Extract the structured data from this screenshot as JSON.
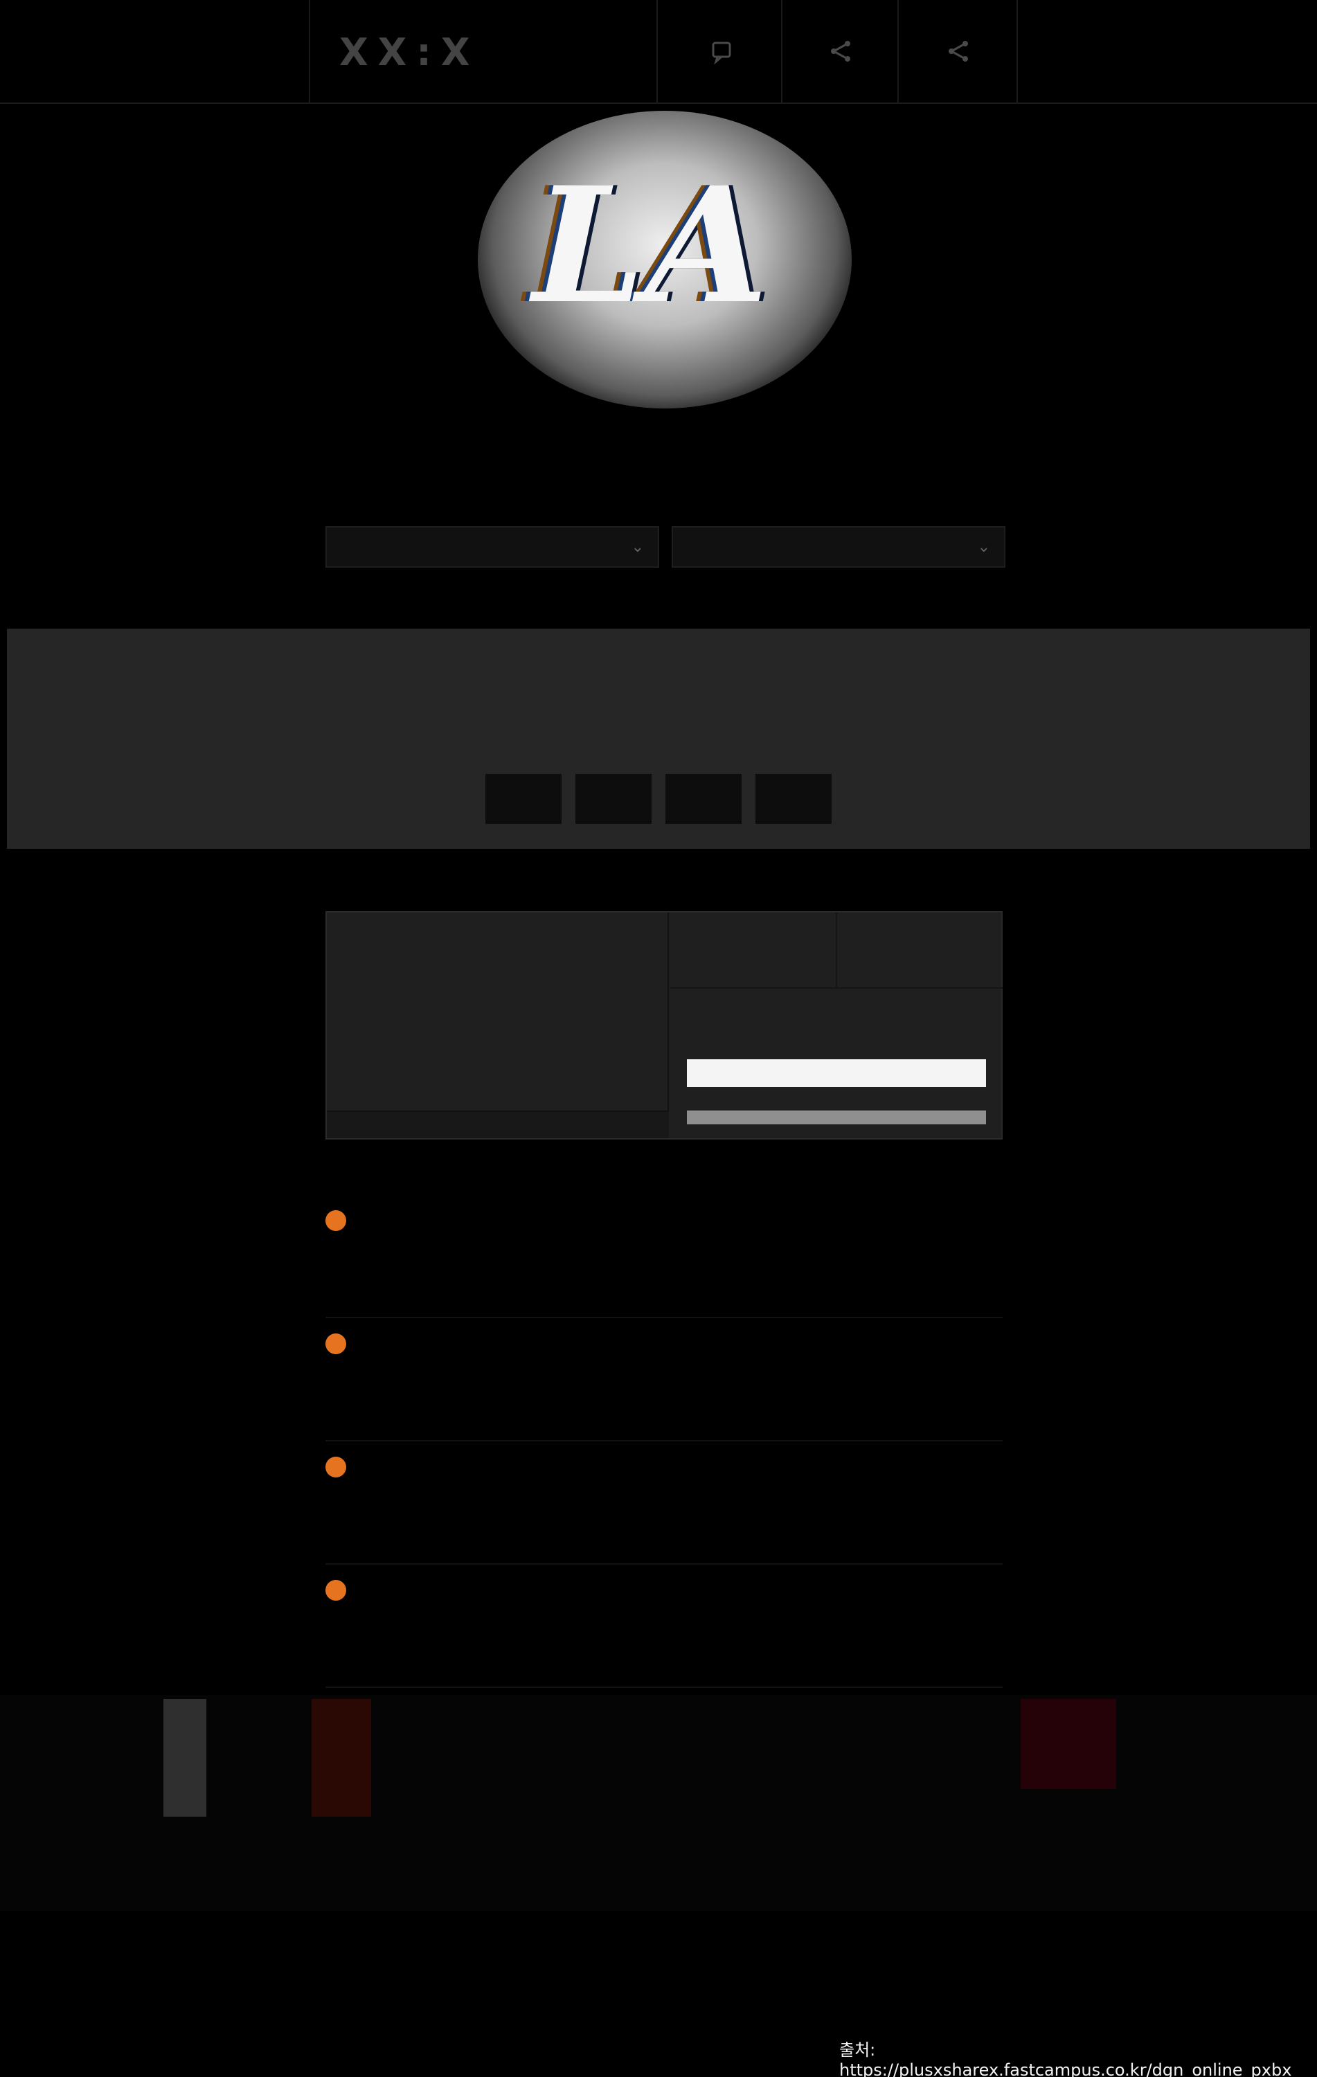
{
  "header": {
    "logo": "XX:X",
    "logo_sub": "",
    "icons": [
      "chat-icon",
      "share-icon",
      "share-alt-icon"
    ]
  },
  "hero": {
    "image_glyph": "LA",
    "title": "",
    "subtitle": "",
    "tags": [
      "",
      "",
      "",
      "",
      ""
    ]
  },
  "selects": [
    {
      "value": ""
    },
    {
      "value": ""
    }
  ],
  "notice": {
    "brand": "",
    "text_before": "",
    "highlight": "",
    "text_after": "",
    "buttons": [
      "",
      "",
      "",
      ""
    ]
  },
  "course_card": {
    "title": "",
    "note_line1": "",
    "note_line2": "",
    "footer_text": "",
    "options": [
      {
        "top": "",
        "label": ""
      },
      {
        "top": "",
        "label": ""
      }
    ],
    "price": "",
    "buy_label": ""
  },
  "info_rows": [
    {
      "label": "",
      "line1": "",
      "line2": "",
      "desc1": "",
      "desc2": ""
    },
    {
      "label": "",
      "line1": "",
      "line2": "",
      "desc1": "",
      "desc2": ""
    },
    {
      "label": "",
      "line1": "",
      "line2": "",
      "desc1": "",
      "desc2": ""
    },
    {
      "label": "",
      "line1": "",
      "line2": "",
      "desc1": "",
      "desc2": ""
    }
  ],
  "instructor": {
    "brand": "",
    "subtitle": "",
    "title": "",
    "desc_line1": "",
    "desc_line2": ""
  },
  "bottom": {
    "heading": "",
    "line1": "",
    "line2": ""
  },
  "source": "출처: https://plusxsharex.fastcampus.co.kr/dgn_online_pxbx",
  "colors": {
    "accent": "#e96d1e",
    "background": "#000000",
    "band": "#262626"
  }
}
